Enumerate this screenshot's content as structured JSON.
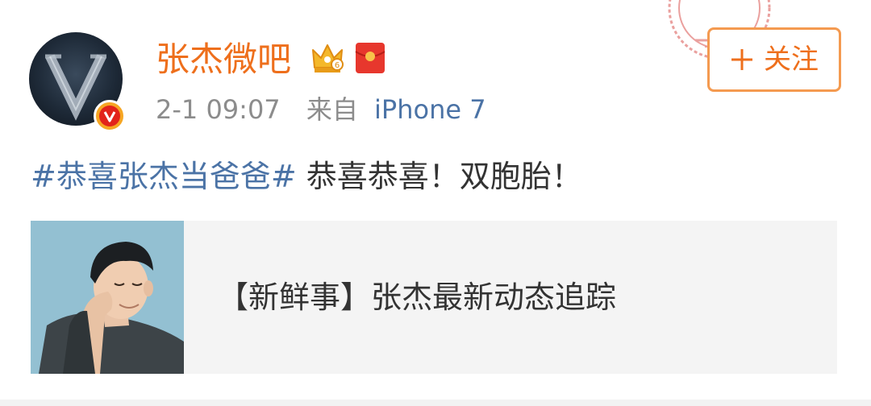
{
  "user": {
    "name": "张杰微吧",
    "avatar_letter": "V",
    "badge_letter": "V"
  },
  "meta": {
    "time": "2-1 09:07",
    "from_label": "来自",
    "device": "iPhone 7"
  },
  "follow": {
    "label": "关注"
  },
  "post": {
    "hashtag": "#恭喜张杰当爸爸#",
    "body": "恭喜恭喜！双胞胎！"
  },
  "link_card": {
    "title": "【新鲜事】张杰最新动态追踪"
  },
  "colors": {
    "username": "#ee6f1c",
    "link_blue": "#4b73a6",
    "follow_border": "#f49a50",
    "meta_gray": "#8c8c8c",
    "card_bg": "#f4f4f4"
  },
  "icons": {
    "crown": "crown-icon",
    "red_packet": "red-packet-icon",
    "plus": "plus-icon",
    "verified": "verified-badge-icon"
  }
}
